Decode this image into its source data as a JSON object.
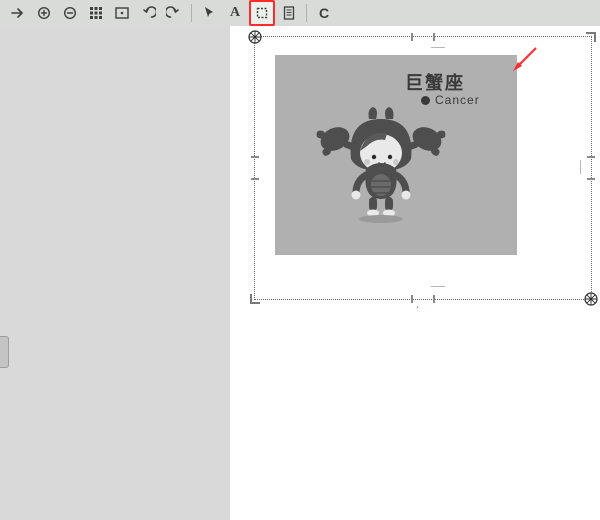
{
  "toolbar": {
    "tools": [
      {
        "name": "forward-arrow-icon",
        "interactable": true
      },
      {
        "name": "zoom-in-icon",
        "interactable": true
      },
      {
        "name": "zoom-out-icon",
        "interactable": true
      },
      {
        "name": "grid-icon",
        "interactable": true
      },
      {
        "name": "fit-screen-icon",
        "interactable": true
      },
      {
        "name": "undo-icon",
        "interactable": true
      },
      {
        "name": "redo-icon",
        "interactable": true
      },
      {
        "name": "sep"
      },
      {
        "name": "pointer-icon",
        "interactable": true
      },
      {
        "name": "text-tool-icon",
        "interactable": true,
        "label": "A"
      },
      {
        "name": "crop-tool-icon",
        "interactable": true,
        "selected": true
      },
      {
        "name": "document-icon",
        "interactable": true
      },
      {
        "name": "sep"
      },
      {
        "name": "refresh-icon",
        "interactable": true,
        "label": "C"
      }
    ]
  },
  "image": {
    "title_cn": "巨蟹座",
    "title_en": "Cancer"
  }
}
